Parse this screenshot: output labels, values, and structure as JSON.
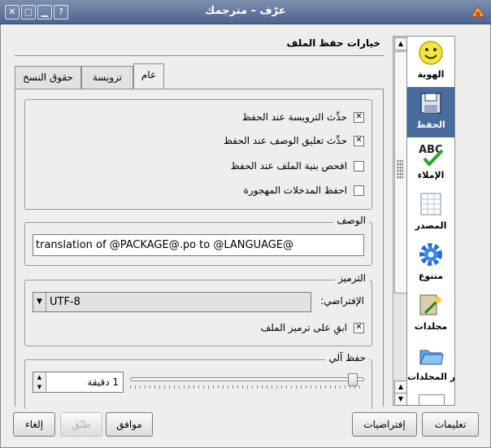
{
  "window": {
    "title": "عرّف – مترجمك",
    "buttons": [
      "close",
      "maximize",
      "minimize",
      "help"
    ]
  },
  "page_title": "خيارات حفظ الملف",
  "sidebar": {
    "items": [
      {
        "label": "الهوية",
        "icon": "smiley-icon"
      },
      {
        "label": "الحفظ",
        "icon": "floppy-disk-icon",
        "selected": true
      },
      {
        "label": "الإملاء",
        "icon": "spellcheck-icon"
      },
      {
        "label": "المصدر",
        "icon": "source-table-icon"
      },
      {
        "label": "متنوع",
        "icon": "gear-icon"
      },
      {
        "label": "مجلدات",
        "icon": "folders-icon"
      },
      {
        "label": "أوامر المجلدات",
        "icon": "folder-commands-icon"
      }
    ]
  },
  "tabs": [
    {
      "label": "عام",
      "active": true
    },
    {
      "label": "ترويسة"
    },
    {
      "label": "حقوق النسخ"
    }
  ],
  "general": {
    "checkboxes": [
      {
        "label": "حدِّث الترويسة عند الحفظ",
        "checked": true
      },
      {
        "label": "حدِّث تعليق الوصف عند الحفظ",
        "checked": true
      },
      {
        "label": "افحص بنية الملف عند الحفظ",
        "checked": false
      },
      {
        "label": "احفظ المدخلات المهجورة",
        "checked": false
      }
    ],
    "description": {
      "legend": "الوصف",
      "value": "translation of @PACKAGE@.po to @LANGUAGE@"
    },
    "encoding": {
      "legend": "الترميز",
      "default_label": "الإفتراضي:",
      "default_value": "UTF-8",
      "keep_label": "ابقِ على ترميز الملف",
      "keep_checked": true
    },
    "autosave": {
      "legend": "حفظ آلي",
      "value": "1 دقيقة",
      "slider_fraction": 0.97
    }
  },
  "buttons": {
    "help": "تعليمات",
    "defaults": "إفتراضيات",
    "ok": "موافق",
    "apply": "طبّق",
    "cancel": "إلغاء"
  },
  "colors": {
    "titlebar": "#5b709a",
    "selected": "#4a6b9e"
  }
}
